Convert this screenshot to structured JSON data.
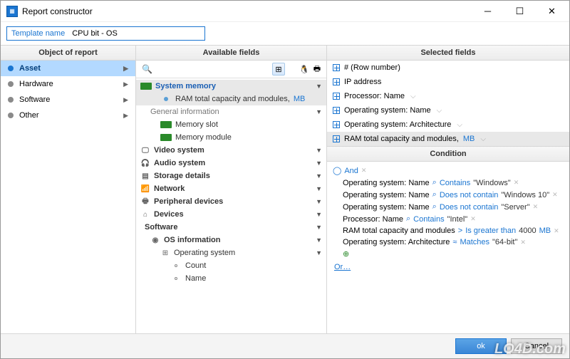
{
  "window": {
    "title": "Report constructor"
  },
  "template": {
    "label": "Template name",
    "value": "CPU bit - OS"
  },
  "columns": {
    "object": "Object of report",
    "available": "Available fields",
    "selected": "Selected fields",
    "condition": "Condition"
  },
  "object_items": [
    {
      "label": "Asset",
      "selected": true
    },
    {
      "label": "Hardware",
      "selected": false
    },
    {
      "label": "Software",
      "selected": false
    },
    {
      "label": "Other",
      "selected": false
    }
  ],
  "search": {
    "placeholder": ""
  },
  "tree": {
    "sysmem": "System memory",
    "ram_line": "RAM total capacity and modules, ",
    "mb": "MB",
    "geninfo": "General information",
    "memslot": "Memory slot",
    "memmod": "Memory module",
    "video": "Video system",
    "audio": "Audio system",
    "storage": "Storage details",
    "network": "Network",
    "periph": "Peripheral devices",
    "devices": "Devices",
    "software": "Software",
    "osinfo": "OS information",
    "os": "Operating system",
    "count": "Count",
    "name": "Name"
  },
  "selected": [
    {
      "label": "# (Row number)",
      "filter": false
    },
    {
      "label": "IP address",
      "filter": false
    },
    {
      "label": "Processor: Name",
      "filter": true
    },
    {
      "label": "Operating system: Name",
      "filter": true
    },
    {
      "label": "Operating system: Architecture",
      "filter": true
    },
    {
      "label": "RAM total capacity and modules, ",
      "mb": "MB",
      "filter": true,
      "hl": true
    }
  ],
  "conditions": {
    "root": "And",
    "rows": [
      {
        "field": "Operating system: Name",
        "op": "Contains",
        "val": "\"Windows\"",
        "ico": "ci"
      },
      {
        "field": "Operating system: Name",
        "op": "Does not contain",
        "val": "\"Windows 10\"",
        "ico": "ci"
      },
      {
        "field": "Operating system: Name",
        "op": "Does not contain",
        "val": "\"Server\"",
        "ico": "ci"
      },
      {
        "field": "Processor: Name",
        "op": "Contains",
        "val": "\"Intel\"",
        "ico": "ci"
      },
      {
        "field": "RAM total capacity and modules",
        "op": "Is greater than",
        "val": "4000",
        "unit": "MB",
        "ico": "gt"
      },
      {
        "field": "Operating system: Architecture",
        "op": "Matches",
        "val": "\"64-bit\"",
        "ico": "mt"
      }
    ],
    "or": "Or…"
  },
  "buttons": {
    "ok": "ok",
    "cancel": "Cancel"
  },
  "watermark": "LO4D.com"
}
